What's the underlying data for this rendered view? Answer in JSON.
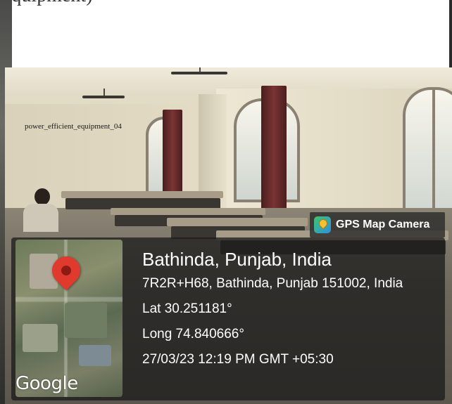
{
  "document": {
    "clipped_top_text": "equipment)",
    "image_label": "power_efficient_equipment_04"
  },
  "gps_overlay": {
    "app_name": "GPS Map Camera",
    "app_icon": "gps-map-camera-icon",
    "map_icon": "map-pin-icon",
    "map_brand": "Google",
    "place": "Bathinda, Punjab, India",
    "address": "7R2R+H68, Bathinda, Punjab 151002, India",
    "latitude": "Lat 30.251181°",
    "longitude": "Long 74.840666°",
    "timestamp": "27/03/23 12:19 PM GMT +05:30"
  },
  "colors": {
    "pin": "#e03a2f",
    "overlay": "#191919",
    "text": "#ffffff"
  }
}
